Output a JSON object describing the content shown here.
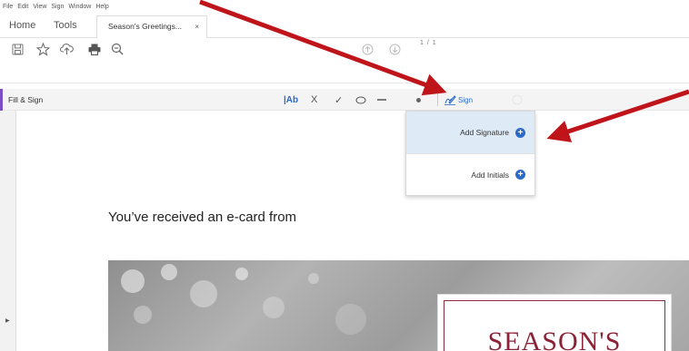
{
  "menu": {
    "items": [
      "File",
      "Edit",
      "View",
      "Sign",
      "Window",
      "Help"
    ]
  },
  "tabs": {
    "home": "Home",
    "tools": "Tools",
    "document": "Season's Greetings...",
    "close": "×"
  },
  "toolbar": {
    "icons": [
      "save-icon",
      "bookmark-star-icon",
      "cloud-upload-icon",
      "print-icon",
      "zoom-out-icon",
      "page-up-icon",
      "page-down-icon"
    ],
    "page_current": "1",
    "page_total": "/ 1"
  },
  "fill_sign": {
    "title": "Fill & Sign",
    "text_tool": "|Ab",
    "cross_tool": "X",
    "check_tool": "✓",
    "sign_label": "Sign",
    "accent_color": "#7b4fc4"
  },
  "dropdown": {
    "add_signature": "Add Signature",
    "add_initials": "Add Initials",
    "highlight_color": "#deebf6",
    "plus_color": "#2a6ac8"
  },
  "document": {
    "body_text": "You’ve received an e-card from",
    "card_title": "SEASON'S",
    "card_color": "#8b2236"
  },
  "annotations": {
    "arrow_color": "#c0141b"
  }
}
